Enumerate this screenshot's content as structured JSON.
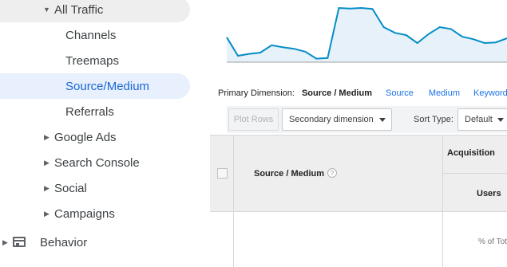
{
  "sidebar": {
    "all_traffic": "All Traffic",
    "channels": "Channels",
    "treemaps": "Treemaps",
    "source_medium": "Source/Medium",
    "referrals": "Referrals",
    "google_ads": "Google Ads",
    "search_console": "Search Console",
    "social": "Social",
    "campaigns": "Campaigns",
    "behavior": "Behavior"
  },
  "chart_data": {
    "type": "area",
    "series": [
      {
        "values": [
          78,
          20,
          26,
          30,
          53,
          47,
          42,
          33,
          11,
          13,
          170,
          168,
          170,
          167,
          110,
          92,
          85,
          60,
          88,
          110,
          104,
          80,
          72,
          60,
          62,
          75
        ]
      }
    ],
    "color": "#058dc7",
    "fill": "#e6f1f9"
  },
  "primary_dimension": {
    "label": "Primary Dimension:",
    "current": "Source / Medium",
    "links": [
      "Source",
      "Medium",
      "Keyword"
    ]
  },
  "toolbar": {
    "plot_rows": "Plot Rows",
    "secondary_dimension": "Secondary dimension",
    "sort_type_label": "Sort Type:",
    "sort_type_value": "Default"
  },
  "table": {
    "dimension_header": "Source / Medium",
    "group_header": "Acquisition",
    "users_header": "Users",
    "pct_text": "% of Tot"
  }
}
